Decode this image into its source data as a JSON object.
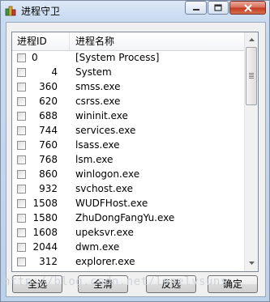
{
  "window": {
    "title": "进程守卫"
  },
  "list": {
    "columns": [
      "进程ID",
      "进程名称"
    ],
    "rows": [
      {
        "pid": "0",
        "name": "[System Process]"
      },
      {
        "pid": "4",
        "name": "System"
      },
      {
        "pid": "360",
        "name": "smss.exe"
      },
      {
        "pid": "620",
        "name": "csrss.exe"
      },
      {
        "pid": "688",
        "name": "wininit.exe"
      },
      {
        "pid": "744",
        "name": "services.exe"
      },
      {
        "pid": "760",
        "name": "lsass.exe"
      },
      {
        "pid": "768",
        "name": "lsm.exe"
      },
      {
        "pid": "860",
        "name": "winlogon.exe"
      },
      {
        "pid": "932",
        "name": "svchost.exe"
      },
      {
        "pid": "1508",
        "name": "WUDFHost.exe"
      },
      {
        "pid": "1580",
        "name": "ZhuDongFangYu.exe"
      },
      {
        "pid": "1608",
        "name": "upeksvr.exe"
      },
      {
        "pid": "2044",
        "name": "dwm.exe"
      },
      {
        "pid": "312",
        "name": "explorer.exe"
      }
    ]
  },
  "buttons": {
    "select_all": "全选",
    "clear_all": "全清",
    "invert": "反选",
    "ok": "确定"
  },
  "watermark": "http://blog.csdn.net/lonelysuns",
  "colors": {
    "title_gradient_top": "#dce8f6",
    "close_button": "#c23a20",
    "list_background": "#ffffff"
  }
}
